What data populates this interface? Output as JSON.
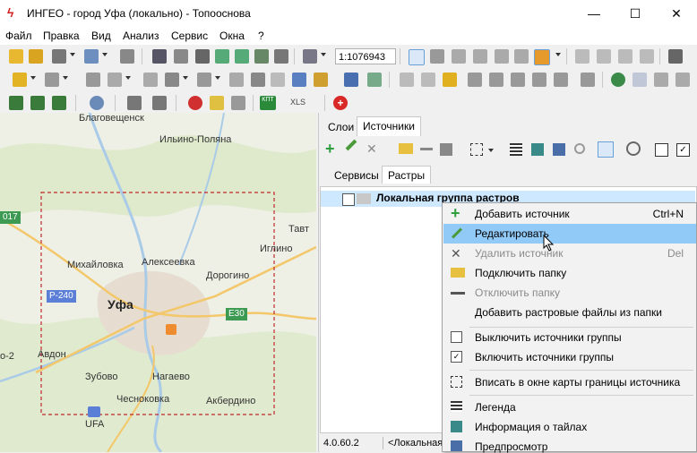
{
  "window": {
    "title": "ИНГЕО - город Уфа (локально) - Топооснова",
    "minimize": "—",
    "maximize": "☐",
    "close": "✕"
  },
  "menu": [
    "Файл",
    "Правка",
    "Вид",
    "Анализ",
    "Сервис",
    "Окна",
    "?"
  ],
  "toolbar": {
    "scale_value": "1:1076943",
    "xls_label": "XLS",
    "kpt_label": "КПТ"
  },
  "map": {
    "cities": [
      {
        "id": "blagoveshchensk",
        "name": "Благовещенск"
      },
      {
        "id": "ilino-polyana",
        "name": "Ильино-Поляна"
      },
      {
        "id": "tavt",
        "name": "Тавт"
      },
      {
        "id": "iglino",
        "name": "Иглино"
      },
      {
        "id": "mikhaylovka",
        "name": "Михайловка"
      },
      {
        "id": "alekseevka",
        "name": "Алексеевка"
      },
      {
        "id": "dorogino",
        "name": "Дорогино"
      },
      {
        "id": "ufa",
        "name": "Уфа"
      },
      {
        "id": "avdon",
        "name": "Авдон"
      },
      {
        "id": "zubovo",
        "name": "Зубово"
      },
      {
        "id": "nagaevo",
        "name": "Нагаево"
      },
      {
        "id": "chesnokovka",
        "name": "Чесноковка"
      },
      {
        "id": "akberdino",
        "name": "Акбердино"
      },
      {
        "id": "ufa-airport",
        "name": "UFA"
      },
      {
        "id": "zo",
        "name": "о-2"
      }
    ],
    "road_labels": {
      "p240": "P-240",
      "e30": "E30",
      "r017": "017"
    }
  },
  "panel": {
    "tabs": [
      "Слои",
      "Источники"
    ],
    "active_tab": "Источники",
    "subtabs": [
      "Сервисы",
      "Растры"
    ],
    "active_subtab": "Растры",
    "tree_root": "Локальная группа растров",
    "status_version": "4.0.60.2",
    "status_text": "<Локальная"
  },
  "context_menu": {
    "items": [
      {
        "label": "Добавить источник",
        "shortcut": "Ctrl+N",
        "icon": "plus-icon",
        "enabled": true
      },
      {
        "label": "Редактировать",
        "shortcut": "",
        "icon": "pencil-icon",
        "enabled": true,
        "highlighted": true
      },
      {
        "label": "Удалить источник",
        "shortcut": "Del",
        "icon": "x-icon",
        "enabled": false
      },
      {
        "label": "Подключить папку",
        "shortcut": "",
        "icon": "folder-plus-icon",
        "enabled": true
      },
      {
        "label": "Отключить папку",
        "shortcut": "",
        "icon": "minus-icon",
        "enabled": false
      },
      {
        "label": "Добавить растровые файлы из папки",
        "shortcut": "",
        "icon": "",
        "enabled": true
      },
      {
        "label": "Выключить источники группы",
        "shortcut": "",
        "icon": "checkbox-empty-icon",
        "enabled": true
      },
      {
        "label": "Включить источники группы",
        "shortcut": "",
        "icon": "checkbox-checked-icon",
        "enabled": true
      },
      {
        "label": "Вписать в окне карты границы источника",
        "shortcut": "",
        "icon": "fit-bounds-icon",
        "enabled": true
      },
      {
        "label": "Легенда",
        "shortcut": "",
        "icon": "legend-icon",
        "enabled": true
      },
      {
        "label": "Информация о тайлах",
        "shortcut": "",
        "icon": "tile-info-icon",
        "enabled": true
      },
      {
        "label": "Предпросмотр",
        "shortcut": "",
        "icon": "preview-icon",
        "enabled": true
      }
    ]
  },
  "colors": {
    "accent_highlight": "#91c9f7",
    "selection": "#cde8ff",
    "plus_green": "#2e9e3e",
    "dashed_frame": "#c0282d"
  }
}
